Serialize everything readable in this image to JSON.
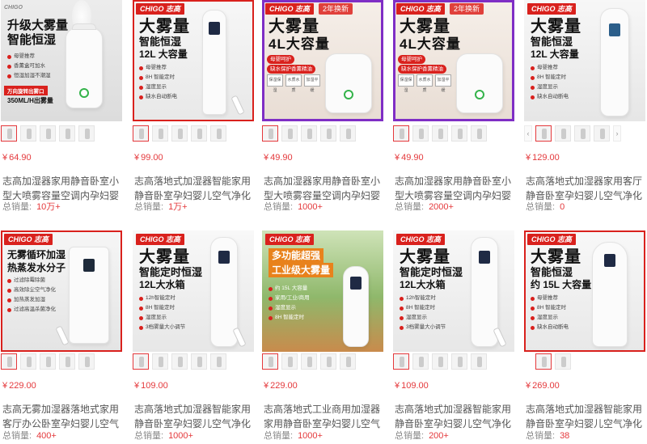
{
  "products": [
    {
      "brand": "CHIGO",
      "headline": "升级大雾量",
      "sub": "智能恒湿",
      "features": [
        "母婴推荐",
        "香薰盒可加水",
        "恒湿加湿不潮湿"
      ],
      "spec_sub": "万向旋转出雾口",
      "spec": "350ML/H出雾量",
      "price_currency": "¥",
      "price": "64.90",
      "title": "志高加湿器家用静音卧室小型大喷雾容量空调内孕妇婴儿空气香薰机",
      "sales_label": "总销量:",
      "sales": "10万+"
    },
    {
      "brand": "CHIGO 志高",
      "headline": "大雾量",
      "sub": "智能恒湿",
      "line3": "12L 大容量",
      "features": [
        "母婴推荐",
        "8H 智能定时",
        "湿度显示",
        "缺水自动断电"
      ],
      "price_currency": "¥",
      "price": "99.00",
      "title": "志高落地式加湿器智能家用静音卧室孕妇婴儿空气净化大容量雾量机",
      "sales_label": "总销量:",
      "sales": "1万+"
    },
    {
      "brand": "CHIGO 志高",
      "new_tag": "2年换新",
      "headline": "大雾量",
      "sub": "4L大容量",
      "pills": [
        "母婴呵护",
        "缺水保护香薰精油"
      ],
      "chips": [
        "保湿保湿",
        "水质水质",
        "加湿平缓"
      ],
      "price_currency": "¥",
      "price": "49.90",
      "title": "志高加湿器家用静音卧室小型大喷雾容量空调内孕妇婴儿空气香薰机",
      "sales_label": "总销量:",
      "sales": "1000+"
    },
    {
      "brand": "CHIGO 志高",
      "new_tag": "2年换新",
      "headline": "大雾量",
      "sub": "4L大容量",
      "pills": [
        "母婴呵护",
        "缺水保护香薰精油"
      ],
      "chips": [
        "保湿保湿",
        "水质水质",
        "加湿平缓"
      ],
      "price_currency": "¥",
      "price": "49.90",
      "title": "志高加湿器家用静音卧室小型大喷雾容量空调内孕妇婴儿空气香薰机",
      "sales_label": "总销量:",
      "sales": "2000+"
    },
    {
      "brand": "CHIGO 志高",
      "headline": "大雾量",
      "sub": "智能恒湿",
      "line3": "12L 大容量",
      "features": [
        "母婴推荐",
        "8H 智能定时",
        "湿度显示",
        "缺水自动断电"
      ],
      "price_currency": "¥",
      "price": "129.00",
      "title": "志高落地式加湿器家用客厅静音卧室孕妇婴儿空气净化大容量喷雾器",
      "sales_label": "总销量:",
      "sales": "0"
    },
    {
      "brand": "CHIGO 志高",
      "headline": "无雾循环加湿",
      "sub": "热蒸发水分子",
      "features": [
        "过滤除霉除菌",
        "高效除尘空气净化",
        "加热蒸发加湿",
        "过滤高温杀菌净化"
      ],
      "price_currency": "¥",
      "price": "229.00",
      "title": "志高无雾加湿器落地式家用客厅办公卧室孕妇婴儿空气净化器",
      "sales_label": "总销量:",
      "sales": "400+"
    },
    {
      "brand": "CHIGO 志高",
      "headline": "大雾量",
      "sub": "智能定时恒湿",
      "line3": "12L大水箱",
      "features": [
        "12h智能定时",
        "8H 智能定时",
        "湿度显示",
        "3档雾量大小调节"
      ],
      "price_currency": "¥",
      "price": "109.00",
      "title": "志高落地式加湿器智能家用静音卧室孕妇婴儿空气净化大容量雾量机",
      "sales_label": "总销量:",
      "sales": "1000+"
    },
    {
      "brand": "CHIGO 志高",
      "headline": "多功能超强",
      "sub": "工业级大雾量",
      "features": [
        "约 15L 大容量",
        "家用/工业/商用",
        "湿度显示",
        "8H 智能定时"
      ],
      "price_currency": "¥",
      "price": "229.00",
      "title": "志高落地式工业商用加湿器家用静音卧室孕妇婴儿空气净化大喷雾客厅",
      "sales_label": "总销量:",
      "sales": "1000+"
    },
    {
      "brand": "CHIGO 志高",
      "headline": "大雾量",
      "sub": "智能定时恒湿",
      "line3": "12L大水箱",
      "features": [
        "12h智能定时",
        "8H 智能定时",
        "湿度显示",
        "3档雾量大小调节"
      ],
      "price_currency": "¥",
      "price": "109.00",
      "title": "志高落地式加湿器智能家用静音卧室孕妇婴儿空气净化大容量雾量机",
      "sales_label": "总销量:",
      "sales": "200+"
    },
    {
      "brand": "CHIGO 志高",
      "headline": "大雾量",
      "sub": "智能恒湿",
      "line3": "约 15L 大容量",
      "features": [
        "母婴推荐",
        "8H 智能定时",
        "湿度显示",
        "缺水自动断电"
      ],
      "price_currency": "¥",
      "price": "269.00",
      "title": "志高落地式加湿器智能家用静音卧室孕妇婴儿空气净化大容量雾量机",
      "sales_label": "总销量:",
      "sales": "38"
    }
  ],
  "colors": {
    "price": "#e4393c",
    "brand_red": "#d9211d",
    "accent_purple": "#7f2ec5",
    "knob_green": "#34b34a"
  },
  "icons": {
    "thumb_prev": "‹",
    "thumb_next": "›"
  }
}
